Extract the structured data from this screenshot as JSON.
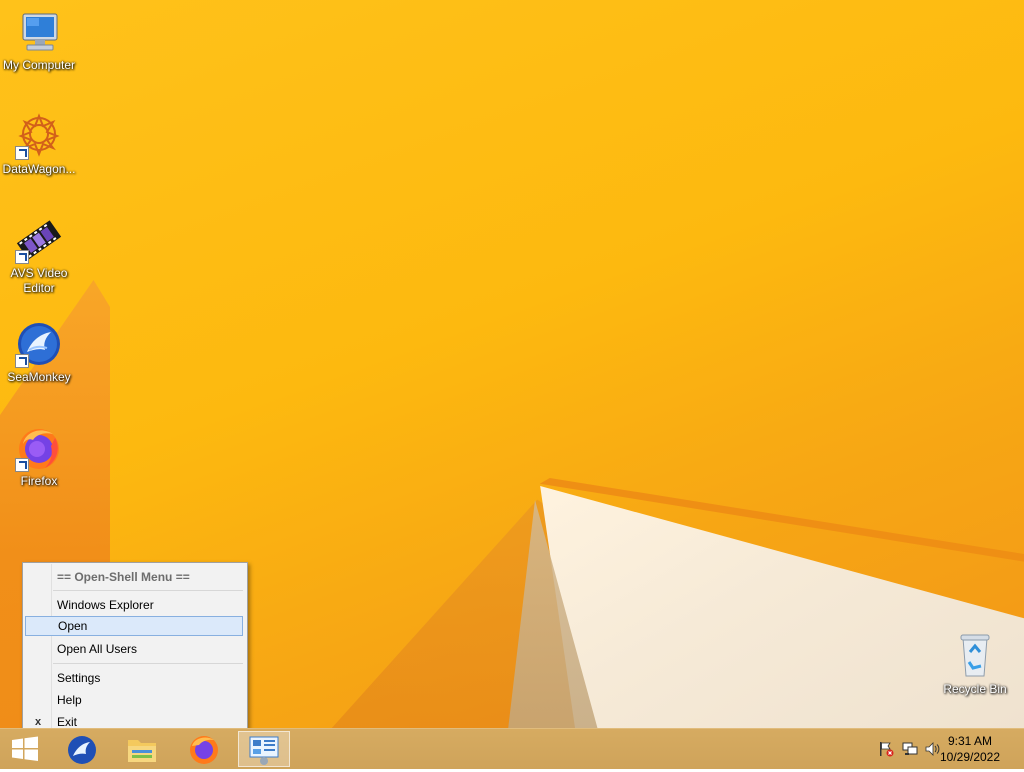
{
  "desktop": {
    "icons": [
      {
        "label": "My Computer",
        "icon": "computer-icon"
      },
      {
        "label": "DataWagon...",
        "icon": "datawagon-icon"
      },
      {
        "label": "AVS Video Editor",
        "icon": "film-icon"
      },
      {
        "label": "SeaMonkey",
        "icon": "seamonkey-icon"
      },
      {
        "label": "Firefox",
        "icon": "firefox-icon"
      },
      {
        "label": "Recycle Bin",
        "icon": "recycle-bin-icon"
      }
    ]
  },
  "context_menu": {
    "header": "== Open-Shell Menu ==",
    "items": [
      {
        "label": "Windows Explorer"
      },
      {
        "label": "Open",
        "highlighted": true
      },
      {
        "label": "Open All Users"
      },
      {
        "label": "Settings"
      },
      {
        "label": "Help"
      },
      {
        "label": "Exit",
        "mark": "x"
      }
    ]
  },
  "taskbar": {
    "pinned": [
      {
        "name": "start-button",
        "icon": "windows-logo-icon"
      },
      {
        "name": "seamonkey",
        "icon": "seamonkey-icon"
      },
      {
        "name": "file-explorer",
        "icon": "folder-icon"
      },
      {
        "name": "firefox",
        "icon": "firefox-icon"
      },
      {
        "name": "open-shell",
        "icon": "control-panel-icon",
        "active": true
      }
    ],
    "tray": {
      "icons": [
        "action-center-flag-icon",
        "network-icon",
        "volume-icon"
      ],
      "time": "9:31 AM",
      "date": "10/29/2022"
    }
  },
  "colors": {
    "wallpaper": "#fdb90f",
    "menu_highlight": "#dbe9fa",
    "taskbar": "#d6ab61"
  }
}
